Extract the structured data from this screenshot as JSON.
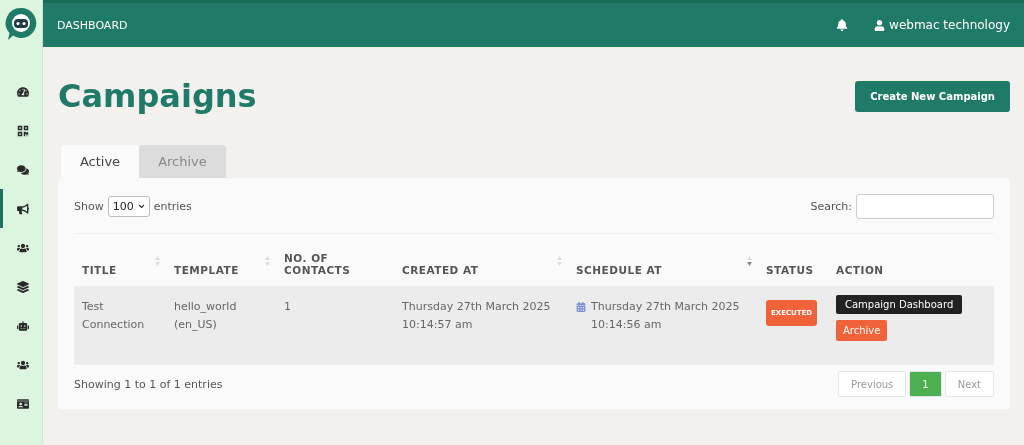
{
  "sidebar": {
    "items": [
      {
        "selected": false
      },
      {
        "selected": false
      },
      {
        "selected": false
      },
      {
        "selected": true
      },
      {
        "selected": false
      },
      {
        "selected": false
      },
      {
        "selected": false
      },
      {
        "selected": false
      },
      {
        "selected": false
      }
    ]
  },
  "header": {
    "title": "DASHBOARD",
    "user": "webmac technology"
  },
  "page": {
    "title": "Campaigns",
    "create_button": "Create New Campaign"
  },
  "tabs": [
    {
      "label": "Active",
      "selected": true
    },
    {
      "label": "Archive",
      "selected": false
    }
  ],
  "table_controls": {
    "show_label": "Show",
    "page_size": "100",
    "entries_label": "entries",
    "search_label": "Search:"
  },
  "table": {
    "columns": [
      {
        "label": "TITLE",
        "kind": "sortable"
      },
      {
        "label": "TEMPLATE",
        "kind": "sortable"
      },
      {
        "label": "NO. OF CONTACTS",
        "kind": "plain"
      },
      {
        "label": "CREATED AT",
        "kind": "sortable"
      },
      {
        "label": "SCHEDULE AT",
        "kind": "sorted"
      },
      {
        "label": "STATUS",
        "kind": "plain"
      },
      {
        "label": "ACTION",
        "kind": "plain"
      }
    ],
    "rows": [
      {
        "title": "Test Connection",
        "template": "hello_world (en_US)",
        "contacts": "1",
        "created_at": "Thursday 27th March 2025 10:14:57 am",
        "schedule_at": "Thursday 27th March 2025 10:14:56 am",
        "status": "EXECUTED",
        "actions": [
          "Campaign Dashboard",
          "Archive"
        ]
      }
    ]
  },
  "footer": {
    "info": "Showing 1 to 1 of 1 entries",
    "pagination": [
      {
        "label": "Previous",
        "selected": false
      },
      {
        "label": "1",
        "selected": true
      },
      {
        "label": "Next",
        "selected": false
      }
    ]
  }
}
